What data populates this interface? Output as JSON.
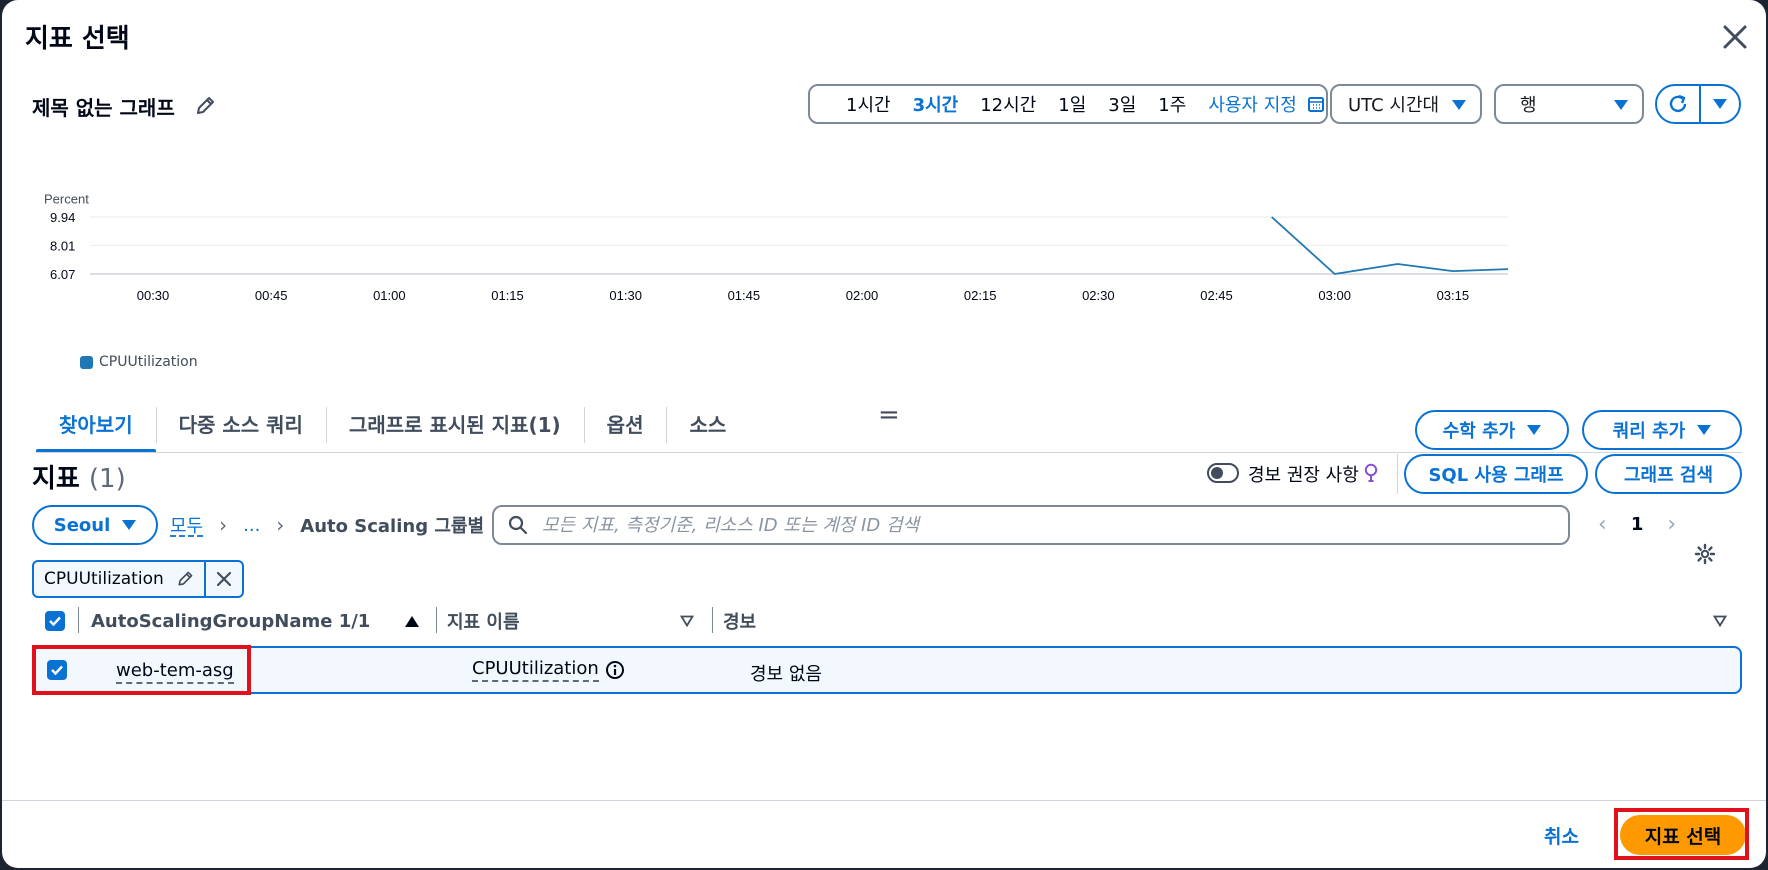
{
  "dialog": {
    "title": "지표 선택",
    "graph_title": "제목 없는 그래프"
  },
  "time_range": {
    "options": [
      "1시간",
      "3시간",
      "12시간",
      "1일",
      "3일",
      "1주"
    ],
    "active": "3시간",
    "custom_label": "사용자 지정",
    "timezone": "UTC 시간대",
    "view": "행"
  },
  "chart_data": {
    "type": "line",
    "ylabel": "Percent",
    "y_ticks": [
      "9.94",
      "8.01",
      "6.07"
    ],
    "x_ticks": [
      "00:30",
      "00:45",
      "01:00",
      "01:15",
      "01:30",
      "01:45",
      "02:00",
      "02:15",
      "02:30",
      "02:45",
      "03:00",
      "03:15"
    ],
    "ylim": [
      6.07,
      9.94
    ],
    "series": [
      {
        "name": "CPUUtilization",
        "color": "#1f77b4",
        "x": [
          "02:52",
          "03:00",
          "03:08",
          "03:15",
          "03:22"
        ],
        "values": [
          9.94,
          6.07,
          6.75,
          6.27,
          6.4
        ]
      }
    ]
  },
  "tabs": [
    {
      "label": "찾아보기",
      "active": true
    },
    {
      "label": "다중 소스 쿼리",
      "active": false
    },
    {
      "label": "그래프로 표시된 지표(1)",
      "active": false
    },
    {
      "label": "옵션",
      "active": false
    },
    {
      "label": "소스",
      "active": false
    }
  ],
  "actions": {
    "add_math": "수학 추가",
    "add_query": "쿼리 추가",
    "sql_graph": "SQL 사용 그래프",
    "search_graph": "그래프 검색"
  },
  "metrics": {
    "heading": "지표",
    "count": "(1)",
    "alarm_recommendations": "경보 권장 사항"
  },
  "browse": {
    "region": "Seoul",
    "breadcrumbs": [
      "모두",
      "...",
      "Auto Scaling 그룹별"
    ],
    "search_placeholder": "모든 지표, 측정기준, 리소스 ID 또는 계정 ID 검색",
    "page": "1",
    "filter_token": "CPUUtilization"
  },
  "table": {
    "columns": [
      "AutoScalingGroupName 1/1",
      "지표 이름",
      "경보"
    ],
    "rows": [
      {
        "group": "web-tem-asg",
        "metric": "CPUUtilization",
        "alarm": "경보 없음",
        "checked": true
      }
    ]
  },
  "footer": {
    "cancel": "취소",
    "submit": "지표 선택"
  },
  "colors": {
    "accent": "#0972d3",
    "primary_button": "#ff9900",
    "highlight": "#e0111b"
  }
}
